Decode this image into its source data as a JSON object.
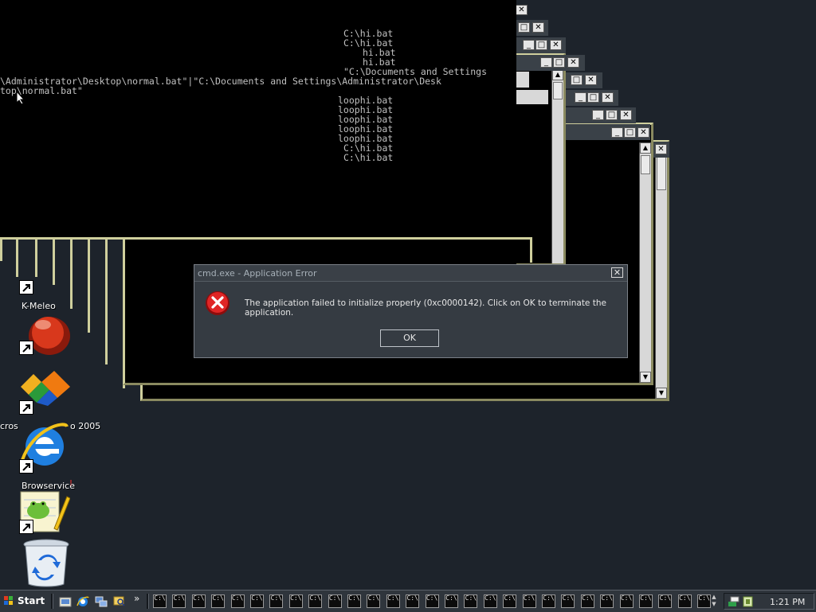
{
  "console": {
    "lines": [
      "C:\\hi.bat",
      "C:\\hi.bat",
      "hi.bat",
      "hi.bat",
      "\"C:\\Documents and Settings",
      "\\Administrator\\Desktop\\normal.bat\"|\"C:\\Documents and Settings\\Administrator\\Desk",
      "top\\normal.bat\"",
      "loophi.bat",
      "loophi.bat",
      "loophi.bat",
      "loophi.bat",
      "loophi.bat",
      "C:\\hi.bat",
      "C:\\hi.bat"
    ]
  },
  "desktop": {
    "icons": [
      {
        "label": "K-Meleo",
        "icon": "k-meleon-icon"
      },
      {
        "label": "",
        "icon": "red-sphere-icon"
      },
      {
        "label": "cros",
        "label2": "o 2005",
        "icon": "visual-studio-icon"
      },
      {
        "label": "",
        "icon": "internet-explorer-icon"
      },
      {
        "label": "Browservice",
        "icon": "notepad-frog-icon"
      },
      {
        "label": "",
        "icon": "recycle-bin-icon"
      }
    ]
  },
  "dialog": {
    "title": "cmd.exe - Application Error",
    "message": "The application failed to initialize properly (0xc0000142). Click on OK to terminate the application.",
    "ok_label": "OK",
    "close_glyph": "✕",
    "icon": "error-icon"
  },
  "taskbar": {
    "start_label": "Start",
    "quick_launch": [
      "show-desktop-icon",
      "internet-explorer-icon",
      "network-icon",
      "search-icon"
    ],
    "chevron": "»",
    "task_button_text": "C:\\",
    "task_count": 29,
    "clock": "1:21 PM"
  },
  "colors": {
    "desktop": "#1d232b",
    "frame": "#cfcf9d",
    "dialog_bg": "#353b42",
    "error_red": "#d81e1e"
  }
}
